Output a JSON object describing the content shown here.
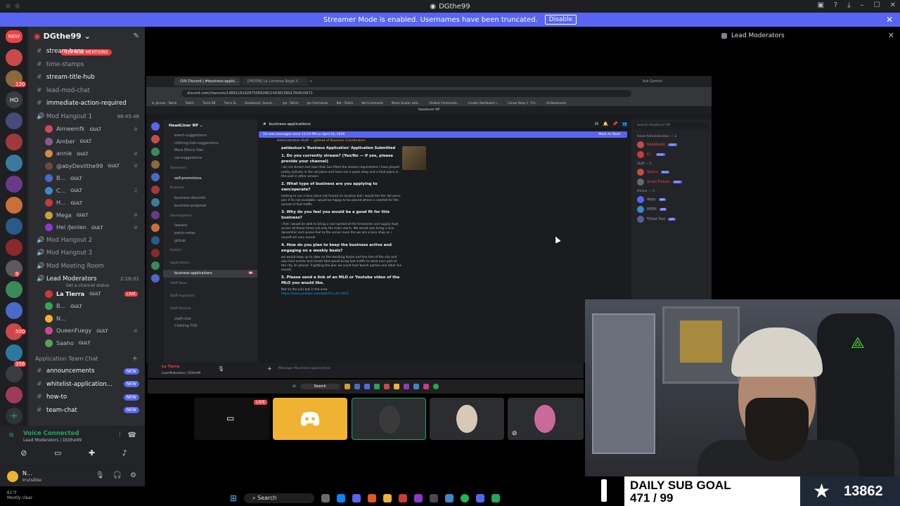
{
  "window": {
    "title": "DGthe99"
  },
  "banner": {
    "text": "Streamer Mode is enabled. Usernames have been truncated.",
    "disable": "Disable"
  },
  "rail": {
    "new_badge": "NEW",
    "badges": [
      "120",
      "9",
      "500",
      "356",
      "HO"
    ]
  },
  "guild": {
    "name": "DGthe99"
  },
  "mentions": "423 NEW MENTIONS",
  "channels": [
    {
      "name": "stream-bans",
      "bright": true
    },
    {
      "name": "time-stamps",
      "bright": false
    },
    {
      "name": "stream-title-hub",
      "bright": true
    },
    {
      "name": "lead-mod-chat",
      "bright": false
    },
    {
      "name": "immediate-action-required",
      "bright": true
    }
  ],
  "voice_mod1": {
    "name": "Mod Hangout 1",
    "time": "98:45:48"
  },
  "mod1_members": [
    {
      "name": "Aimeemfk",
      "tag": "GULT",
      "color": "#c94a5a"
    },
    {
      "name": "Amber",
      "tag": "GULT",
      "color": "#8a5a8a"
    },
    {
      "name": "annie",
      "tag": "GULT",
      "color": "#d08a4a"
    },
    {
      "name": "@abyDevilthe99",
      "tag": "GULT",
      "color": "#6a4a3a"
    },
    {
      "name": "B...",
      "tag": "GULT",
      "color": "#4a6ac9"
    },
    {
      "name": "C...",
      "tag": "GULT",
      "color": "#3a8ac9"
    },
    {
      "name": "H...",
      "tag": "GULT",
      "color": "#c93a3a"
    },
    {
      "name": "Mega",
      "tag": "GULT",
      "color": "#c9a03a"
    },
    {
      "name": "Hel /Jenlen",
      "tag": "GULT",
      "color": "#8a3ac9"
    }
  ],
  "voice_rooms": [
    "Mod Hangout 2",
    "Mod Hangout 3",
    "Mod Meeting Room"
  ],
  "lead_mods": {
    "name": "Lead Moderators",
    "time": "2:16:01",
    "status": "Set a channel status"
  },
  "lead_members": [
    {
      "name": "La Tierra",
      "badge": "LIVE",
      "tag": "GULT",
      "color": "#c93a3a"
    },
    {
      "name": "B...",
      "badge": "",
      "tag": "GULT",
      "color": "#3aa05a"
    },
    {
      "name": "N...",
      "badge": "",
      "tag": "",
      "color": "#f0b232"
    },
    {
      "name": "QueenFuegy",
      "badge": "",
      "tag": "GULT",
      "color": "#c94a8a"
    },
    {
      "name": "Saaho",
      "badge": "",
      "tag": "GULT",
      "color": "#5aa05a"
    }
  ],
  "app_category": "Application Team Chat",
  "app_channels": [
    {
      "name": "announcements",
      "new": "NEW"
    },
    {
      "name": "whitelist-application...",
      "new": "NEW"
    },
    {
      "name": "how-to",
      "new": "NEW"
    },
    {
      "name": "team-chat",
      "new": "NEW"
    }
  ],
  "voice_panel": {
    "status": "Voice Connected",
    "sub": "Lead Moderators / DGthe99"
  },
  "user": {
    "name": "N...",
    "status": "Invisible"
  },
  "weather": {
    "temp": "61°F",
    "desc": "Mostly clear"
  },
  "right_panel": {
    "title": "Lead Moderators"
  },
  "browser": {
    "tabs": [
      "(54) Discord | #business-applic...",
      "[PADDB] La Linnema Regal li..."
    ],
    "gemini": "Ask Gemini",
    "url": "discord.com/channels/1489118162875066286/1493815801780633671",
    "bookmarks": [
      "la_lennae - Twitch",
      "Twitch",
      "Tierra RB",
      "Tierra SL",
      "Dashboard | Sound...",
      "Joe - Twitch",
      "Joe Commands",
      "Nat - Twitch",
      "Nat Commands",
      "Movie Quotes with...",
      "Chatbot Commands...",
      "Creator Dashboard |...",
      "Censor Beep 1 - Fro...",
      "All Bookmarks"
    ],
    "inner_title": "HeadLiner RP"
  },
  "inner_server": {
    "name": "HeadLiner RP",
    "items": [
      {
        "label": "event-suggestions",
        "type": "ch"
      },
      {
        "label": "clothing-hair-suggestions",
        "type": "ch"
      },
      {
        "label": "More Ethnic Hair",
        "type": "ch"
      },
      {
        "label": "car-suggestions",
        "type": "ch"
      },
      {
        "label": "Streamers",
        "type": "cat"
      },
      {
        "label": "self-promotions",
        "type": "ch"
      },
      {
        "label": "Business",
        "type": "cat"
      },
      {
        "label": "business-discords",
        "type": "ch"
      },
      {
        "label": "business-proposal",
        "type": "ch"
      },
      {
        "label": "Development",
        "type": "cat"
      },
      {
        "label": "teasers",
        "type": "ch"
      },
      {
        "label": "patch-notes",
        "type": "ch"
      },
      {
        "label": "github",
        "type": "ch"
      },
      {
        "label": "Faction",
        "type": "cat"
      },
      {
        "label": "Applications",
        "type": "cat"
      },
      {
        "label": "business-applications",
        "type": "sel"
      },
      {
        "label": "Staff Voice",
        "type": "cat"
      },
      {
        "label": "Staff Important",
        "type": "cat"
      },
      {
        "label": "Staff General",
        "type": "cat"
      },
      {
        "label": "staff-chat",
        "type": "ch"
      },
      {
        "label": "Clothing TOS",
        "type": "ch"
      }
    ]
  },
  "inner_channel": {
    "name": "business-applications",
    "new_bar": "16 new messages since 11:53 PM on April 18, 2026",
    "mark": "Mark As Read",
    "sys_prefix": "Administration Staff",
    "sys_role": "@Head of Business Coordinators",
    "submitted": "patdaskux's 'Business Application' Application Submitted",
    "qa": [
      {
        "q": "1. Do you currently stream? (Yes/No — if yes, please provide your channel)",
        "a": "i do not stream but seen that Gus lifted the stream requirement i have played pretty actively in the old place and have ran a pawn shop and a food place in the past in other servers"
      },
      {
        "q": "2. What type of business are you applying to own/operate?",
        "a": "looking to run a taco place not fussed on location but i would like the del perro pier if its not available i would be happy to be placed where is needed for the spread of foot traffic"
      },
      {
        "q": "3. Why do you feel you would be a good fit for this business?",
        "a": "i feel i would be able to bring a nice spread of the timezones and supply food across all these times not only the main storm. We would also bring a nice dynammic and aussie feel to the server even tho we are a taco shop as i myself am very aussie"
      },
      {
        "q": "4. How do you plan to keep the business active and engaging on a weekly basis?",
        "a": "we would keep up to date on the trending fasion and the feel of the city and also host events and meets that would bring foot traffic to what ever part of the city im placed. if getting the pier we could host beach parties and other fun events"
      },
      {
        "q": "5. Please send a link of an MLO or Youtube video of the MLO you would like.",
        "a": "Not on the pier but in the area"
      }
    ],
    "link": "https://www.youtube.com/watch?v=Hc-Y4V4",
    "compose": "Message #business-applications"
  },
  "inner_members": {
    "search": "Search HeadLiner RP",
    "groups": [
      {
        "title": "Head Administration — 2",
        "members": [
          {
            "name": "RedsRadio",
            "tag": "GULT",
            "color": "#c94a4a",
            "red": true
          },
          {
            "name": "D...",
            "tag": "GULT",
            "color": "#c93a3a",
            "red": true
          }
        ]
      },
      {
        "title": "Staff — 2",
        "members": [
          {
            "name": "Saaho",
            "tag": "GULT",
            "color": "#c94a4a",
            "red": true
          },
          {
            "name": "Small Pinkies",
            "tag": "GULT",
            "color": "#6a6a6a",
            "red": false
          }
        ]
      },
      {
        "title": "Online — 3",
        "members": [
          {
            "name": "Appy",
            "tag": "APP",
            "color": "#5865f2",
            "red": false
          },
          {
            "name": "MEE6",
            "tag": "APP",
            "color": "#3a8ac9",
            "red": false
          },
          {
            "name": "Ticket Tool",
            "tag": "APP",
            "color": "#5a5a9a",
            "red": false
          }
        ]
      }
    ]
  },
  "inner_voice": {
    "name": "La Tierra",
    "sub": "Lead Moderators / DGthe99"
  },
  "inner_taskbar": {
    "search": "Search"
  },
  "tiles": {
    "live": "LIVE"
  },
  "sub_goal": {
    "label": "DAILY SUB GOAL",
    "progress": "471 / 99",
    "count": "13862"
  },
  "taskbar": {
    "search": "Search"
  },
  "colors": {
    "blurple": "#5865f2",
    "green": "#23a55a",
    "red": "#f23f43"
  }
}
